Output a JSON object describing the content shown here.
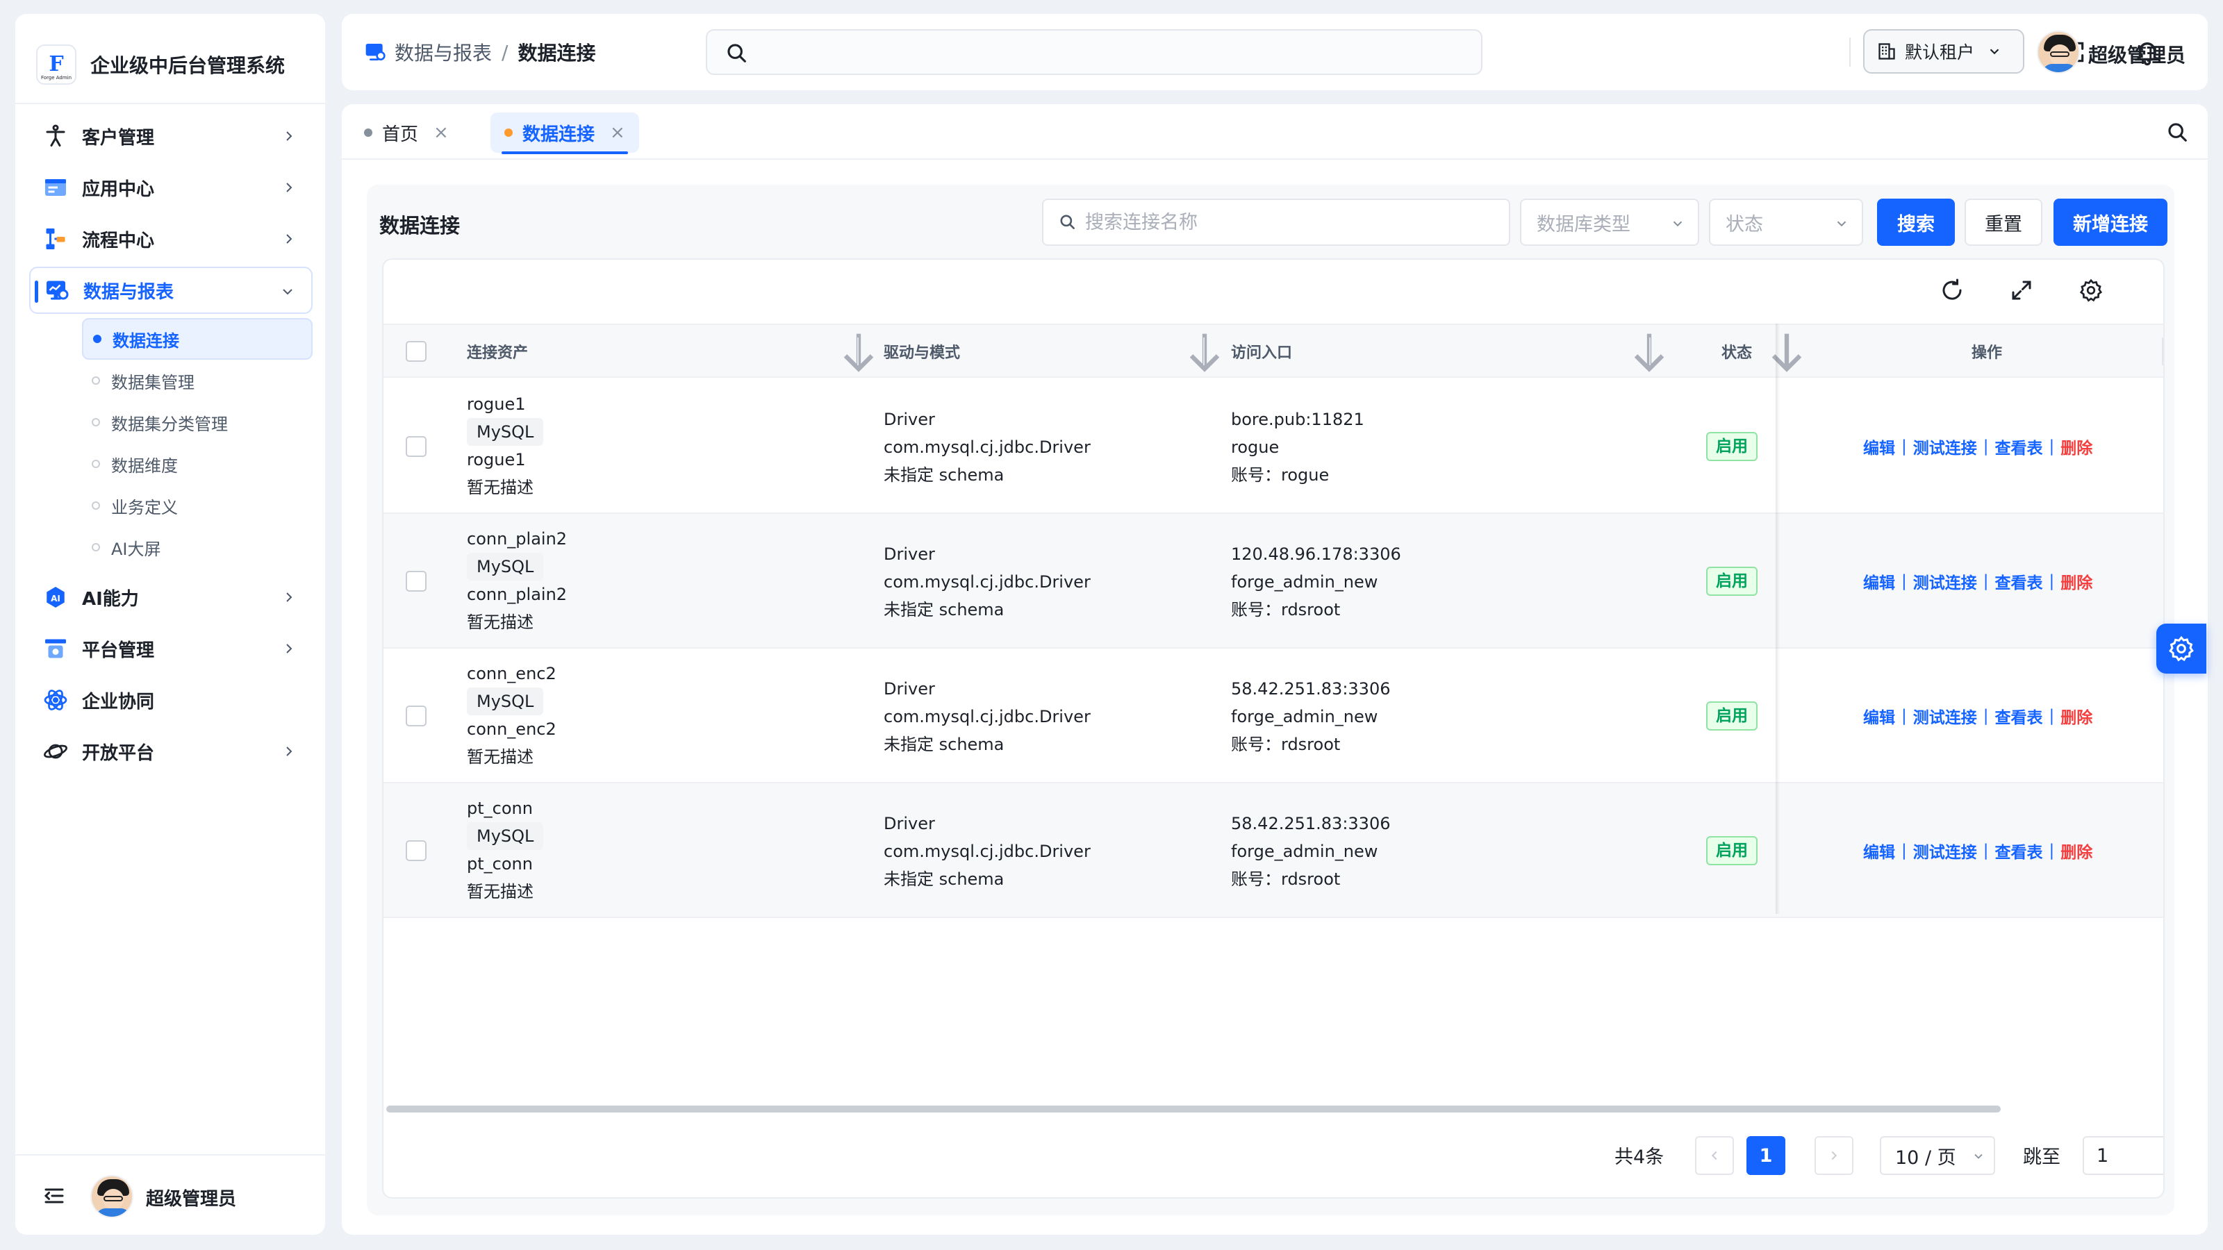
{
  "app": {
    "title": "企业级中后台管理系统",
    "logo_letter": "F",
    "logo_sub": "Forge Admin"
  },
  "sidebar": {
    "items": [
      {
        "label": "客户管理",
        "icon": "person-icon",
        "has_children": true
      },
      {
        "label": "应用中心",
        "icon": "app-window-icon",
        "has_children": true
      },
      {
        "label": "流程中心",
        "icon": "flow-icon",
        "has_children": true
      },
      {
        "label": "数据与报表",
        "icon": "monitor-chart-icon",
        "has_children": true,
        "expanded": true,
        "children": [
          {
            "label": "数据连接",
            "active": true
          },
          {
            "label": "数据集管理"
          },
          {
            "label": "数据集分类管理"
          },
          {
            "label": "数据维度"
          },
          {
            "label": "业务定义"
          },
          {
            "label": "AI大屏"
          }
        ]
      },
      {
        "label": "AI能力",
        "icon": "ai-badge-icon",
        "has_children": true
      },
      {
        "label": "平台管理",
        "icon": "platform-icon",
        "has_children": true
      },
      {
        "label": "企业协同",
        "icon": "collab-icon",
        "has_children": false
      },
      {
        "label": "开放平台",
        "icon": "planet-icon",
        "has_children": true
      }
    ],
    "footer_user": "超级管理员"
  },
  "header": {
    "breadcrumb": [
      "数据与报表",
      "数据连接"
    ],
    "breadcrumb_sep": "/",
    "tenant": "默认租户",
    "user": "超级管理员"
  },
  "tabs": [
    {
      "label": "首页",
      "active": false
    },
    {
      "label": "数据连接",
      "active": true
    }
  ],
  "tab_close": "×",
  "page": {
    "title": "数据连接",
    "search_placeholder": "搜索连接名称",
    "db_type_placeholder": "数据库类型",
    "status_placeholder": "状态",
    "search_btn": "搜索",
    "reset_btn": "重置",
    "add_btn": "新增连接"
  },
  "table": {
    "columns": [
      "连接资产",
      "驱动与模式",
      "访问入口",
      "状态",
      "操作"
    ],
    "rows": [
      {
        "name": "rogue1",
        "type": "MySQL",
        "alias": "rogue1",
        "desc": "暂无描述",
        "driver": "Driver",
        "driver_class": "com.mysql.cj.jdbc.Driver",
        "schema": "未指定 schema",
        "host": "bore.pub:11821",
        "database": "rogue",
        "account": "账号：rogue",
        "status": "启用"
      },
      {
        "name": "conn_plain2",
        "type": "MySQL",
        "alias": "conn_plain2",
        "desc": "暂无描述",
        "driver": "Driver",
        "driver_class": "com.mysql.cj.jdbc.Driver",
        "schema": "未指定 schema",
        "host": "120.48.96.178:3306",
        "database": "forge_admin_new",
        "account": "账号：rdsroot",
        "status": "启用"
      },
      {
        "name": "conn_enc2",
        "type": "MySQL",
        "alias": "conn_enc2",
        "desc": "暂无描述",
        "driver": "Driver",
        "driver_class": "com.mysql.cj.jdbc.Driver",
        "schema": "未指定 schema",
        "host": "58.42.251.83:3306",
        "database": "forge_admin_new",
        "account": "账号：rdsroot",
        "status": "启用"
      },
      {
        "name": "pt_conn",
        "type": "MySQL",
        "alias": "pt_conn",
        "desc": "暂无描述",
        "driver": "Driver",
        "driver_class": "com.mysql.cj.jdbc.Driver",
        "schema": "未指定 schema",
        "host": "58.42.251.83:3306",
        "database": "forge_admin_new",
        "account": "账号：rdsroot",
        "status": "启用"
      }
    ],
    "actions": [
      "编辑",
      "测试连接",
      "查看表",
      "删除"
    ],
    "action_sep": "|"
  },
  "pagination": {
    "total": "共4条",
    "current": "1",
    "page_size": "10 / 页",
    "jump_label": "跳至",
    "jump_value": "1"
  },
  "colors": {
    "primary": "#1664ff",
    "success": "#00a35c",
    "danger": "#f53f3f",
    "background": "#eef1f6"
  }
}
